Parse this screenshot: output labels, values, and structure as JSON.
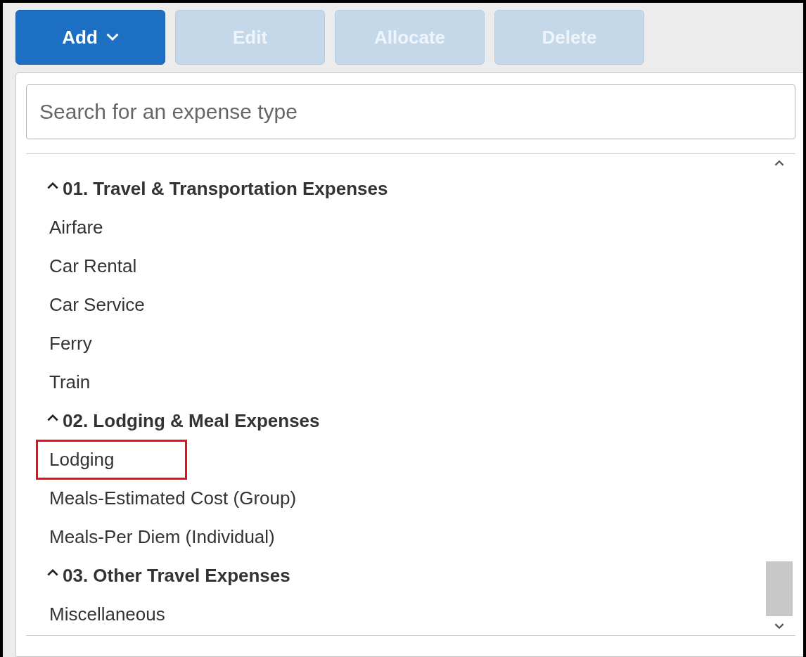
{
  "toolbar": {
    "buttons": [
      {
        "label": "Add",
        "kind": "dropdown",
        "disabled": false
      },
      {
        "label": "Edit",
        "kind": "plain",
        "disabled": true
      },
      {
        "label": "Allocate",
        "kind": "plain",
        "disabled": true
      },
      {
        "label": "Delete",
        "kind": "plain",
        "disabled": true
      }
    ]
  },
  "search": {
    "placeholder": "Search for an expense type"
  },
  "groups": [
    {
      "label": "01. Travel & Transportation Expenses",
      "expanded": true,
      "items": [
        {
          "label": "Airfare",
          "highlighted": false
        },
        {
          "label": "Car Rental",
          "highlighted": false
        },
        {
          "label": "Car Service",
          "highlighted": false
        },
        {
          "label": "Ferry",
          "highlighted": false
        },
        {
          "label": "Train",
          "highlighted": false
        }
      ]
    },
    {
      "label": "02. Lodging & Meal Expenses",
      "expanded": true,
      "items": [
        {
          "label": "Lodging",
          "highlighted": true
        },
        {
          "label": "Meals-Estimated Cost (Group)",
          "highlighted": false
        },
        {
          "label": "Meals-Per Diem (Individual)",
          "highlighted": false
        }
      ]
    },
    {
      "label": "03. Other Travel Expenses",
      "expanded": true,
      "items": [
        {
          "label": "Miscellaneous",
          "highlighted": false
        }
      ]
    }
  ]
}
